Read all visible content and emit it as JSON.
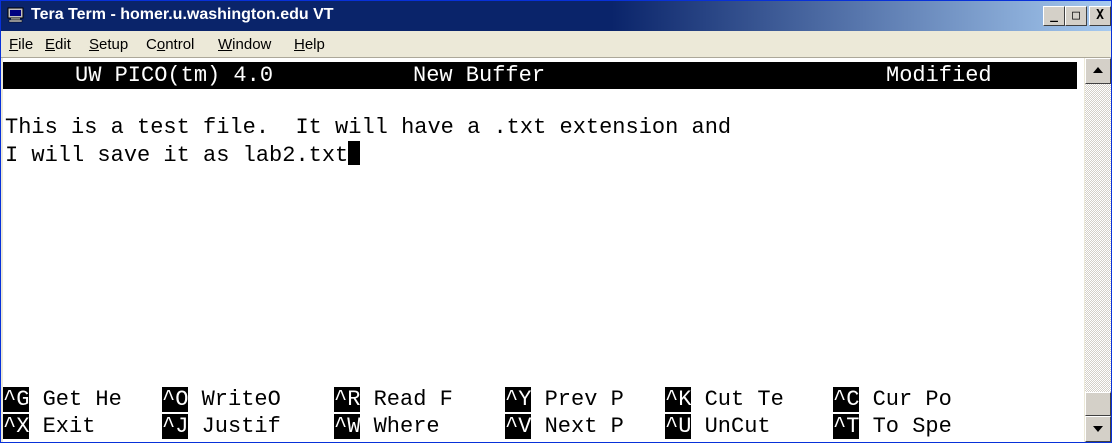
{
  "window": {
    "title": "Tera Term - homer.u.washington.edu VT",
    "controls": {
      "minimize": "_",
      "maximize": "□",
      "close": "X"
    }
  },
  "menu": [
    {
      "label": "File",
      "mnemonic": "F",
      "rest": "ile"
    },
    {
      "label": "Edit",
      "mnemonic": "E",
      "rest": "dit"
    },
    {
      "label": "Setup",
      "mnemonic": "S",
      "rest": "etup"
    },
    {
      "label": "Control",
      "pre": "C",
      "mnemonic": "o",
      "rest": "ntrol"
    },
    {
      "label": "Window",
      "mnemonic": "W",
      "rest": "indow"
    },
    {
      "label": "Help",
      "mnemonic": "H",
      "rest": "elp"
    }
  ],
  "editor": {
    "app_version": "UW PICO(tm) 4.0",
    "buffer": "New Buffer",
    "state": "Modified",
    "lines": [
      "This is a test file.  It will have a .txt extension and",
      "I will save it as lab2.txt"
    ]
  },
  "shortcuts": [
    [
      {
        "key": "^G",
        "label": " Get He"
      },
      {
        "key": "^O",
        "label": " WriteO"
      },
      {
        "key": "^R",
        "label": " Read F"
      },
      {
        "key": "^Y",
        "label": " Prev P"
      },
      {
        "key": "^K",
        "label": " Cut Te"
      },
      {
        "key": "^C",
        "label": " Cur Po"
      }
    ],
    [
      {
        "key": "^X",
        "label": " Exit  "
      },
      {
        "key": "^J",
        "label": " Justif"
      },
      {
        "key": "^W",
        "label": " Where "
      },
      {
        "key": "^V",
        "label": " Next P"
      },
      {
        "key": "^U",
        "label": " UnCut "
      },
      {
        "key": "^T",
        "label": " To Spe"
      }
    ]
  ],
  "colors": {
    "titlebar": "#0a246a",
    "terminal_bg": "#ffffff",
    "terminal_fg": "#000000"
  },
  "icons": [
    "teraterm-app-icon",
    "scroll-up-arrow-icon",
    "scroll-down-arrow-icon"
  ]
}
